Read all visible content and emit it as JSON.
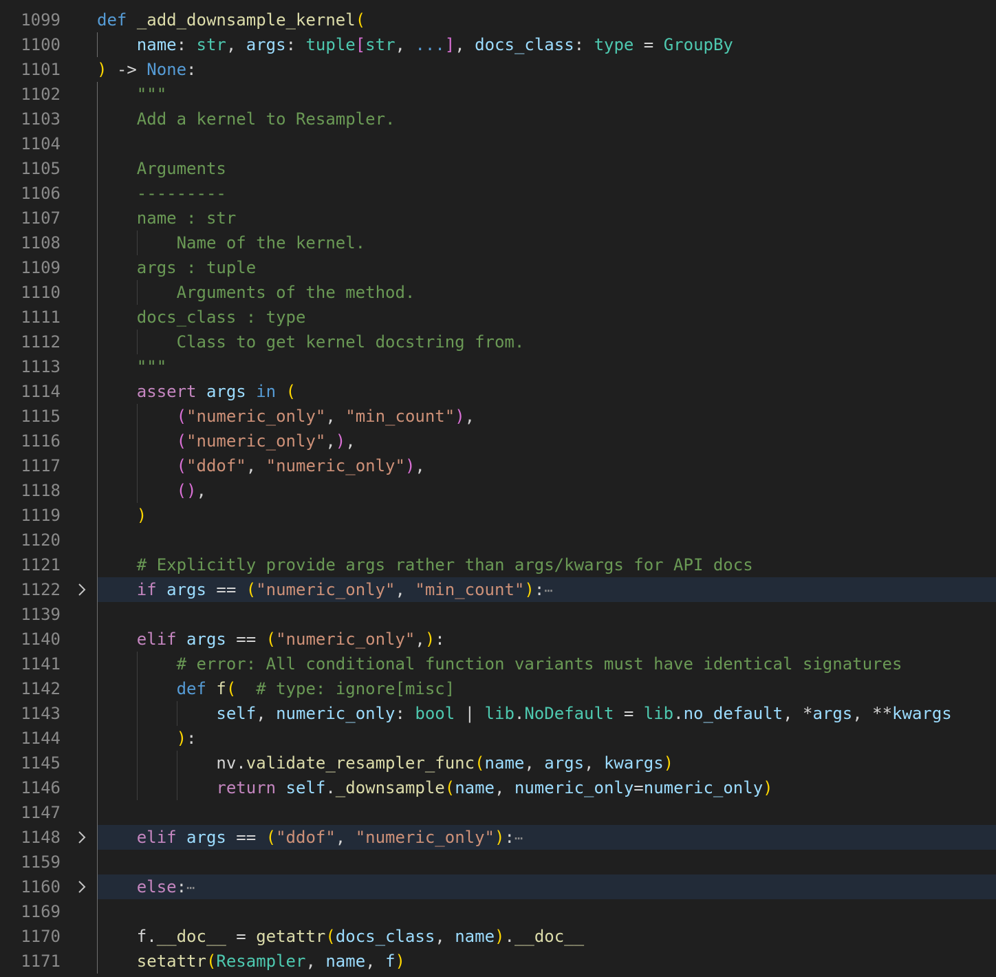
{
  "editor": {
    "language": "python",
    "theme_colors": {
      "background": "#1f1f1f",
      "folded_line_highlight": "#222b38",
      "line_number": "#8a8a8a"
    },
    "lines": [
      {
        "number": "1099",
        "folded": false,
        "indent": 0,
        "tokens": [
          [
            "kw",
            "def"
          ],
          [
            "pn",
            " "
          ],
          [
            "fn",
            "_add_downsample_kernel"
          ],
          [
            "b1",
            "("
          ]
        ]
      },
      {
        "number": "1100",
        "folded": false,
        "indent": 1,
        "tokens": [
          [
            "var",
            "name"
          ],
          [
            "pn",
            ": "
          ],
          [
            "typ",
            "str"
          ],
          [
            "pn",
            ", "
          ],
          [
            "var",
            "args"
          ],
          [
            "pn",
            ": "
          ],
          [
            "typ",
            "tuple"
          ],
          [
            "b2",
            "["
          ],
          [
            "typ",
            "str"
          ],
          [
            "pn",
            ", "
          ],
          [
            "cn",
            "..."
          ],
          [
            "b2",
            "]"
          ],
          [
            "pn",
            ", "
          ],
          [
            "var",
            "docs_class"
          ],
          [
            "pn",
            ": "
          ],
          [
            "typ",
            "type"
          ],
          [
            "pn",
            " = "
          ],
          [
            "typ",
            "GroupBy"
          ]
        ]
      },
      {
        "number": "1101",
        "folded": false,
        "indent": 0,
        "tokens": [
          [
            "b1",
            ")"
          ],
          [
            "pn",
            " -> "
          ],
          [
            "cn",
            "None"
          ],
          [
            "pn",
            ":"
          ]
        ]
      },
      {
        "number": "1102",
        "folded": false,
        "indent": 1,
        "tokens": [
          [
            "com",
            "\"\"\""
          ]
        ]
      },
      {
        "number": "1103",
        "folded": false,
        "indent": 1,
        "tokens": [
          [
            "com",
            "Add a kernel to Resampler."
          ]
        ]
      },
      {
        "number": "1104",
        "folded": false,
        "indent": 0,
        "tokens": []
      },
      {
        "number": "1105",
        "folded": false,
        "indent": 1,
        "tokens": [
          [
            "com",
            "Arguments"
          ]
        ]
      },
      {
        "number": "1106",
        "folded": false,
        "indent": 1,
        "tokens": [
          [
            "com",
            "---------"
          ]
        ]
      },
      {
        "number": "1107",
        "folded": false,
        "indent": 1,
        "tokens": [
          [
            "com",
            "name : str"
          ]
        ]
      },
      {
        "number": "1108",
        "folded": false,
        "indent": 2,
        "tokens": [
          [
            "com",
            "Name of the kernel."
          ]
        ]
      },
      {
        "number": "1109",
        "folded": false,
        "indent": 1,
        "tokens": [
          [
            "com",
            "args : tuple"
          ]
        ]
      },
      {
        "number": "1110",
        "folded": false,
        "indent": 2,
        "tokens": [
          [
            "com",
            "Arguments of the method."
          ]
        ]
      },
      {
        "number": "1111",
        "folded": false,
        "indent": 1,
        "tokens": [
          [
            "com",
            "docs_class : type"
          ]
        ]
      },
      {
        "number": "1112",
        "folded": false,
        "indent": 2,
        "tokens": [
          [
            "com",
            "Class to get kernel docstring from."
          ]
        ]
      },
      {
        "number": "1113",
        "folded": false,
        "indent": 1,
        "tokens": [
          [
            "com",
            "\"\"\""
          ]
        ]
      },
      {
        "number": "1114",
        "folded": false,
        "indent": 1,
        "tokens": [
          [
            "ctl",
            "assert"
          ],
          [
            "pn",
            " "
          ],
          [
            "var",
            "args"
          ],
          [
            "pn",
            " "
          ],
          [
            "kw",
            "in"
          ],
          [
            "pn",
            " "
          ],
          [
            "b1",
            "("
          ]
        ]
      },
      {
        "number": "1115",
        "folded": false,
        "indent": 2,
        "tokens": [
          [
            "b2",
            "("
          ],
          [
            "str",
            "\"numeric_only\""
          ],
          [
            "pn",
            ", "
          ],
          [
            "str",
            "\"min_count\""
          ],
          [
            "b2",
            ")"
          ],
          [
            "pn",
            ","
          ]
        ]
      },
      {
        "number": "1116",
        "folded": false,
        "indent": 2,
        "tokens": [
          [
            "b2",
            "("
          ],
          [
            "str",
            "\"numeric_only\""
          ],
          [
            "pn",
            ","
          ],
          [
            "b2",
            ")"
          ],
          [
            "pn",
            ","
          ]
        ]
      },
      {
        "number": "1117",
        "folded": false,
        "indent": 2,
        "tokens": [
          [
            "b2",
            "("
          ],
          [
            "str",
            "\"ddof\""
          ],
          [
            "pn",
            ", "
          ],
          [
            "str",
            "\"numeric_only\""
          ],
          [
            "b2",
            ")"
          ],
          [
            "pn",
            ","
          ]
        ]
      },
      {
        "number": "1118",
        "folded": false,
        "indent": 2,
        "tokens": [
          [
            "b2",
            "()"
          ],
          [
            "pn",
            ","
          ]
        ]
      },
      {
        "number": "1119",
        "folded": false,
        "indent": 1,
        "tokens": [
          [
            "b1",
            ")"
          ]
        ]
      },
      {
        "number": "1120",
        "folded": false,
        "indent": 0,
        "tokens": []
      },
      {
        "number": "1121",
        "folded": false,
        "indent": 1,
        "tokens": [
          [
            "com",
            "# Explicitly provide args rather than args/kwargs for API docs"
          ]
        ]
      },
      {
        "number": "1122",
        "folded": true,
        "indent": 1,
        "tokens": [
          [
            "ctl",
            "if"
          ],
          [
            "pn",
            " "
          ],
          [
            "var",
            "args"
          ],
          [
            "pn",
            " == "
          ],
          [
            "b1",
            "("
          ],
          [
            "str",
            "\"numeric_only\""
          ],
          [
            "pn",
            ", "
          ],
          [
            "str",
            "\"min_count\""
          ],
          [
            "b1",
            ")"
          ],
          [
            "pn",
            ":"
          ]
        ]
      },
      {
        "number": "1139",
        "folded": false,
        "indent": 0,
        "tokens": []
      },
      {
        "number": "1140",
        "folded": false,
        "indent": 1,
        "tokens": [
          [
            "ctl",
            "elif"
          ],
          [
            "pn",
            " "
          ],
          [
            "var",
            "args"
          ],
          [
            "pn",
            " == "
          ],
          [
            "b1",
            "("
          ],
          [
            "str",
            "\"numeric_only\""
          ],
          [
            "pn",
            ","
          ],
          [
            "b1",
            ")"
          ],
          [
            "pn",
            ":"
          ]
        ]
      },
      {
        "number": "1141",
        "folded": false,
        "indent": 2,
        "tokens": [
          [
            "com",
            "# error: All conditional function variants must have identical signatures"
          ]
        ]
      },
      {
        "number": "1142",
        "folded": false,
        "indent": 2,
        "tokens": [
          [
            "kw",
            "def"
          ],
          [
            "pn",
            " "
          ],
          [
            "fn",
            "f"
          ],
          [
            "b1",
            "("
          ],
          [
            "pn",
            "  "
          ],
          [
            "com",
            "# type: ignore[misc]"
          ]
        ]
      },
      {
        "number": "1143",
        "folded": false,
        "indent": 3,
        "tokens": [
          [
            "var",
            "self"
          ],
          [
            "pn",
            ", "
          ],
          [
            "var",
            "numeric_only"
          ],
          [
            "pn",
            ": "
          ],
          [
            "typ",
            "bool"
          ],
          [
            "pn",
            " | "
          ],
          [
            "typ",
            "lib"
          ],
          [
            "pn",
            "."
          ],
          [
            "typ",
            "NoDefault"
          ],
          [
            "pn",
            " = "
          ],
          [
            "typ",
            "lib"
          ],
          [
            "pn",
            "."
          ],
          [
            "var",
            "no_default"
          ],
          [
            "pn",
            ", "
          ],
          [
            "op",
            "*"
          ],
          [
            "var",
            "args"
          ],
          [
            "pn",
            ", "
          ],
          [
            "op",
            "**"
          ],
          [
            "var",
            "kwargs"
          ]
        ]
      },
      {
        "number": "1144",
        "folded": false,
        "indent": 2,
        "tokens": [
          [
            "b1",
            ")"
          ],
          [
            "pn",
            ":"
          ]
        ]
      },
      {
        "number": "1145",
        "folded": false,
        "indent": 3,
        "tokens": [
          [
            "pn",
            "nv."
          ],
          [
            "fn",
            "validate_resampler_func"
          ],
          [
            "b1",
            "("
          ],
          [
            "var",
            "name"
          ],
          [
            "pn",
            ", "
          ],
          [
            "var",
            "args"
          ],
          [
            "pn",
            ", "
          ],
          [
            "var",
            "kwargs"
          ],
          [
            "b1",
            ")"
          ]
        ]
      },
      {
        "number": "1146",
        "folded": false,
        "indent": 3,
        "tokens": [
          [
            "ctl",
            "return"
          ],
          [
            "pn",
            " "
          ],
          [
            "var",
            "self"
          ],
          [
            "pn",
            "."
          ],
          [
            "fn",
            "_downsample"
          ],
          [
            "b1",
            "("
          ],
          [
            "var",
            "name"
          ],
          [
            "pn",
            ", "
          ],
          [
            "var",
            "numeric_only"
          ],
          [
            "pn",
            "="
          ],
          [
            "var",
            "numeric_only"
          ],
          [
            "b1",
            ")"
          ]
        ]
      },
      {
        "number": "1147",
        "folded": false,
        "indent": 0,
        "tokens": []
      },
      {
        "number": "1148",
        "folded": true,
        "indent": 1,
        "tokens": [
          [
            "ctl",
            "elif"
          ],
          [
            "pn",
            " "
          ],
          [
            "var",
            "args"
          ],
          [
            "pn",
            " == "
          ],
          [
            "b1",
            "("
          ],
          [
            "str",
            "\"ddof\""
          ],
          [
            "pn",
            ", "
          ],
          [
            "str",
            "\"numeric_only\""
          ],
          [
            "b1",
            ")"
          ],
          [
            "pn",
            ":"
          ]
        ]
      },
      {
        "number": "1159",
        "folded": false,
        "indent": 0,
        "tokens": []
      },
      {
        "number": "1160",
        "folded": true,
        "indent": 1,
        "tokens": [
          [
            "ctl",
            "else"
          ],
          [
            "pn",
            ":"
          ]
        ]
      },
      {
        "number": "1169",
        "folded": false,
        "indent": 0,
        "tokens": []
      },
      {
        "number": "1170",
        "folded": false,
        "indent": 1,
        "tokens": [
          [
            "pn",
            "f."
          ],
          [
            "fn",
            "__doc__"
          ],
          [
            "pn",
            " = "
          ],
          [
            "fn",
            "getattr"
          ],
          [
            "b1",
            "("
          ],
          [
            "var",
            "docs_class"
          ],
          [
            "pn",
            ", "
          ],
          [
            "var",
            "name"
          ],
          [
            "b1",
            ")"
          ],
          [
            "pn",
            "."
          ],
          [
            "fn",
            "__doc__"
          ]
        ]
      },
      {
        "number": "1171",
        "folded": false,
        "indent": 1,
        "tokens": [
          [
            "fn",
            "setattr"
          ],
          [
            "b1",
            "("
          ],
          [
            "typ",
            "Resampler"
          ],
          [
            "pn",
            ", "
          ],
          [
            "var",
            "name"
          ],
          [
            "pn",
            ", "
          ],
          [
            "var",
            "f"
          ],
          [
            "b1",
            ")"
          ]
        ]
      }
    ],
    "folded_ellipsis": "⋯",
    "fold_icon": "chevron-right-icon"
  }
}
